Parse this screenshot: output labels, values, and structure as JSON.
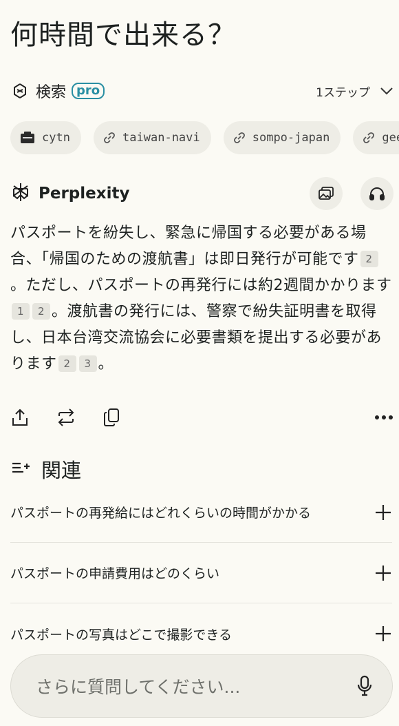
{
  "question": "何時間で出来る？",
  "search": {
    "label": "検索",
    "badge": "pro",
    "steps": "1ステップ",
    "icon": "search-steps-icon"
  },
  "sources": [
    {
      "label": "cytn",
      "icon": "site-favicon-icon"
    },
    {
      "label": "taiwan-navi",
      "icon": "link-icon"
    },
    {
      "label": "sompo-japan",
      "icon": "link-icon"
    },
    {
      "label": "gee",
      "icon": "link-icon"
    }
  ],
  "answer": {
    "brand": "Perplexity",
    "segments": [
      "パスポートを紛失し、緊急に帰国する必要がある場合、「帰国のための渡航書」は即日発行が可能です",
      "。ただし、パスポートの再発行には約2週間かかります",
      "。渡航書の発行には、警察で紛失証明書を取得し、日本台湾交流協会に必要書類を提出する必要があります",
      "。"
    ],
    "citations": {
      "c1": [
        "2"
      ],
      "c2": [
        "1",
        "2"
      ],
      "c3": [
        "2",
        "3"
      ]
    }
  },
  "related": {
    "label": "関連",
    "items": [
      "パスポートの再発給にはどれくらいの時間がかかる",
      "パスポートの申請費用はどのくらい",
      "パスポートの写真はどこで撮影できる"
    ]
  },
  "ask": {
    "placeholder": "さらに質問してください..."
  },
  "colors": {
    "background": "#fbfaf4",
    "accent": "#2a8fa3",
    "chip": "#eeede6"
  }
}
